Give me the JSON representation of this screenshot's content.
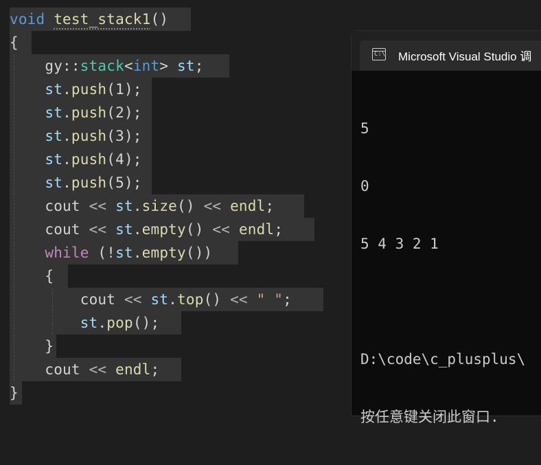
{
  "editor": {
    "lines": [
      {
        "parts": [
          [
            "kw",
            "void"
          ],
          [
            "tx",
            " "
          ],
          [
            "fn",
            "test_stack1"
          ],
          [
            "tx",
            "()"
          ]
        ]
      },
      {
        "parts": [
          [
            "tx",
            "{"
          ]
        ]
      },
      {
        "parts": [
          [
            "tx",
            "    gy::"
          ],
          [
            "ty",
            "stack"
          ],
          [
            "tx",
            "<"
          ],
          [
            "kw",
            "int"
          ],
          [
            "tx",
            "> "
          ],
          [
            "var",
            "st"
          ],
          [
            "tx",
            ";"
          ]
        ]
      },
      {
        "parts": [
          [
            "tx",
            "    "
          ],
          [
            "var",
            "st"
          ],
          [
            "tx",
            "."
          ],
          [
            "fn",
            "push"
          ],
          [
            "tx",
            "(1);"
          ]
        ]
      },
      {
        "parts": [
          [
            "tx",
            "    "
          ],
          [
            "var",
            "st"
          ],
          [
            "tx",
            "."
          ],
          [
            "fn",
            "push"
          ],
          [
            "tx",
            "(2);"
          ]
        ]
      },
      {
        "parts": [
          [
            "tx",
            "    "
          ],
          [
            "var",
            "st"
          ],
          [
            "tx",
            "."
          ],
          [
            "fn",
            "push"
          ],
          [
            "tx",
            "(3);"
          ]
        ]
      },
      {
        "parts": [
          [
            "tx",
            "    "
          ],
          [
            "var",
            "st"
          ],
          [
            "tx",
            "."
          ],
          [
            "fn",
            "push"
          ],
          [
            "tx",
            "(4);"
          ]
        ]
      },
      {
        "parts": [
          [
            "tx",
            "    "
          ],
          [
            "var",
            "st"
          ],
          [
            "tx",
            "."
          ],
          [
            "fn",
            "push"
          ],
          [
            "tx",
            "(5);"
          ]
        ]
      },
      {
        "parts": [
          [
            "tx",
            "    cout "
          ],
          [
            "op",
            "<<"
          ],
          [
            "tx",
            " "
          ],
          [
            "var",
            "st"
          ],
          [
            "tx",
            "."
          ],
          [
            "fn",
            "size"
          ],
          [
            "tx",
            "() "
          ],
          [
            "op",
            "<<"
          ],
          [
            "tx",
            " "
          ],
          [
            "fn",
            "endl"
          ],
          [
            "tx",
            ";"
          ]
        ]
      },
      {
        "parts": [
          [
            "tx",
            "    cout "
          ],
          [
            "op",
            "<<"
          ],
          [
            "tx",
            " "
          ],
          [
            "var",
            "st"
          ],
          [
            "tx",
            "."
          ],
          [
            "fn",
            "empty"
          ],
          [
            "tx",
            "() "
          ],
          [
            "op",
            "<<"
          ],
          [
            "tx",
            " "
          ],
          [
            "fn",
            "endl"
          ],
          [
            "tx",
            ";"
          ]
        ]
      },
      {
        "parts": [
          [
            "tx",
            "    "
          ],
          [
            "kw2",
            "while"
          ],
          [
            "tx",
            " (!"
          ],
          [
            "var",
            "st"
          ],
          [
            "tx",
            "."
          ],
          [
            "fn",
            "empty"
          ],
          [
            "tx",
            "())"
          ]
        ]
      },
      {
        "parts": [
          [
            "tx",
            "    {"
          ]
        ]
      },
      {
        "parts": [
          [
            "tx",
            "        cout "
          ],
          [
            "op",
            "<<"
          ],
          [
            "tx",
            " "
          ],
          [
            "var",
            "st"
          ],
          [
            "tx",
            "."
          ],
          [
            "fn",
            "top"
          ],
          [
            "tx",
            "() "
          ],
          [
            "op",
            "<<"
          ],
          [
            "tx",
            " "
          ],
          [
            "str",
            "\" \""
          ],
          [
            "tx",
            ";"
          ]
        ]
      },
      {
        "parts": [
          [
            "tx",
            "        "
          ],
          [
            "var",
            "st"
          ],
          [
            "tx",
            "."
          ],
          [
            "fn",
            "pop"
          ],
          [
            "tx",
            "();"
          ]
        ]
      },
      {
        "parts": [
          [
            "tx",
            "    }"
          ]
        ]
      },
      {
        "parts": [
          [
            "tx",
            "    cout "
          ],
          [
            "op",
            "<<"
          ],
          [
            "tx",
            " "
          ],
          [
            "fn",
            "endl"
          ],
          [
            "tx",
            ";"
          ]
        ]
      },
      {
        "parts": [
          [
            "tx",
            "}"
          ]
        ]
      }
    ]
  },
  "console": {
    "tab_title": "Microsoft Visual Studio 调",
    "icon_text": "C:\\",
    "output_lines": [
      "5",
      "0",
      "5 4 3 2 1",
      "",
      "D:\\code\\c_plusplus\\",
      "按任意键关闭此窗口."
    ]
  }
}
